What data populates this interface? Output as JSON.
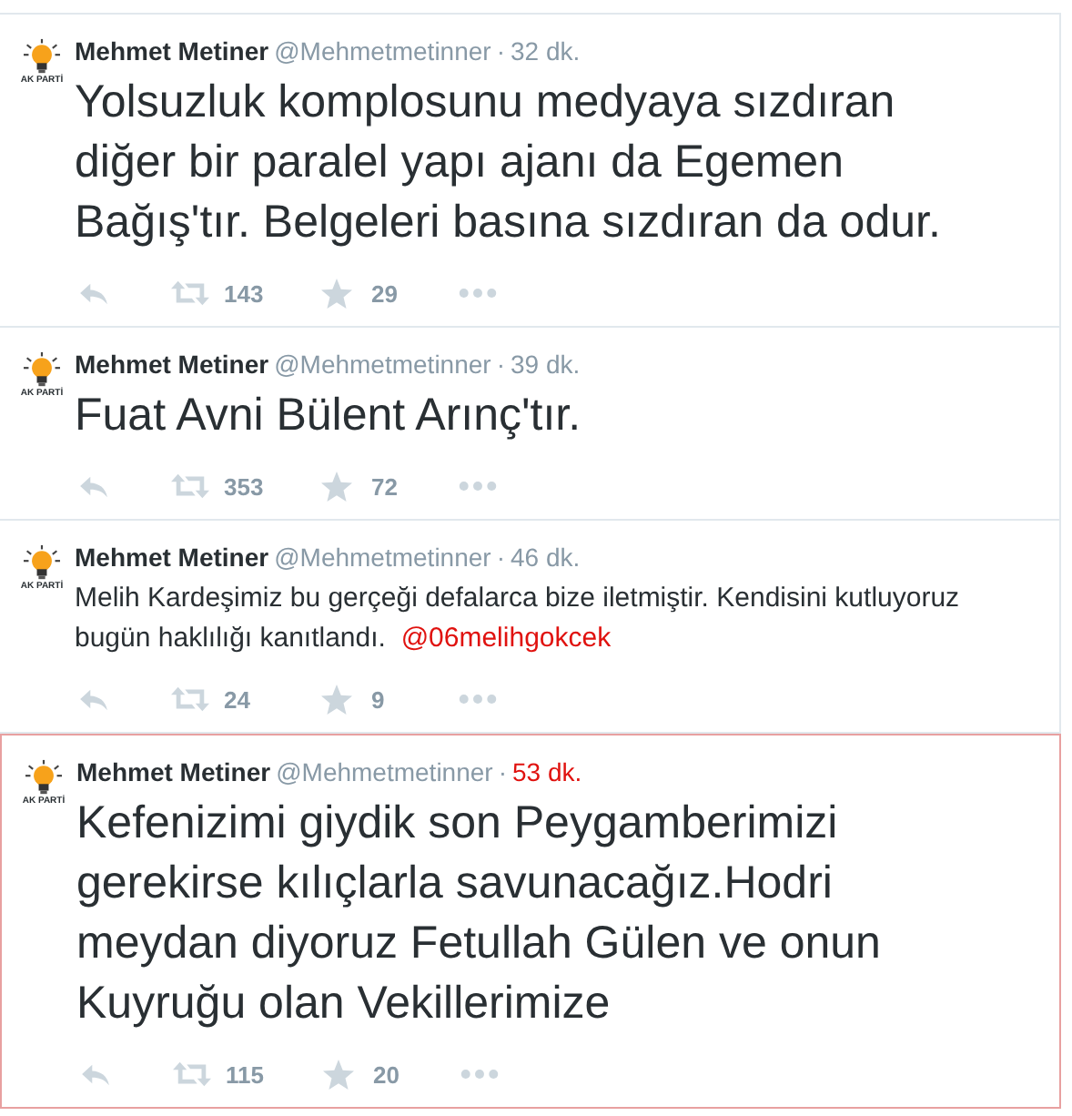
{
  "tweets": [
    {
      "name": "Mehmet Metiner",
      "handle": "@Mehmetmetinner",
      "separator": "·",
      "time": "32 dk.",
      "avatar_label": "AK PARTİ",
      "large_text": true,
      "highlighted": false,
      "text": [
        {
          "kind": "plain",
          "text": "Yolsuzluk komplosunu medyaya sızdıran diğer bir paralel yapı ajanı da Egemen Bağış'tır. Belgeleri basına sızdıran da odur."
        }
      ],
      "retweets": "143",
      "favorites": "29"
    },
    {
      "name": "Mehmet Metiner",
      "handle": "@Mehmetmetinner",
      "separator": "·",
      "time": "39 dk.",
      "avatar_label": "AK PARTİ",
      "large_text": true,
      "highlighted": false,
      "text": [
        {
          "kind": "plain",
          "text": "Fuat Avni Bülent Arınç'tır."
        }
      ],
      "retweets": "353",
      "favorites": "72"
    },
    {
      "name": "Mehmet Metiner",
      "handle": "@Mehmetmetinner",
      "separator": "·",
      "time": "46 dk.",
      "avatar_label": "AK PARTİ",
      "large_text": false,
      "highlighted": false,
      "text": [
        {
          "kind": "plain",
          "text": "Melih Kardeşimiz bu gerçeği defalarca bize iletmiştir. Kendisini kutluyoruz bugün haklılığı kanıtlandı."
        },
        {
          "kind": "mention",
          "text": "@06melihgokcek"
        }
      ],
      "retweets": "24",
      "favorites": "9"
    },
    {
      "name": "Mehmet Metiner",
      "handle": "@Mehmetmetinner",
      "separator": "·",
      "time": "53 dk.",
      "avatar_label": "AK PARTİ",
      "large_text": true,
      "highlighted": true,
      "text": [
        {
          "kind": "plain",
          "text": "Kefenizimi giydik son Peygamberimizi gerekirse kılıçlarla savunacağız.Hodri meydan diyoruz Fetullah Gülen ve onun Kuyruğu olan Vekillerimize"
        }
      ],
      "retweets": "115",
      "favorites": "20"
    }
  ]
}
